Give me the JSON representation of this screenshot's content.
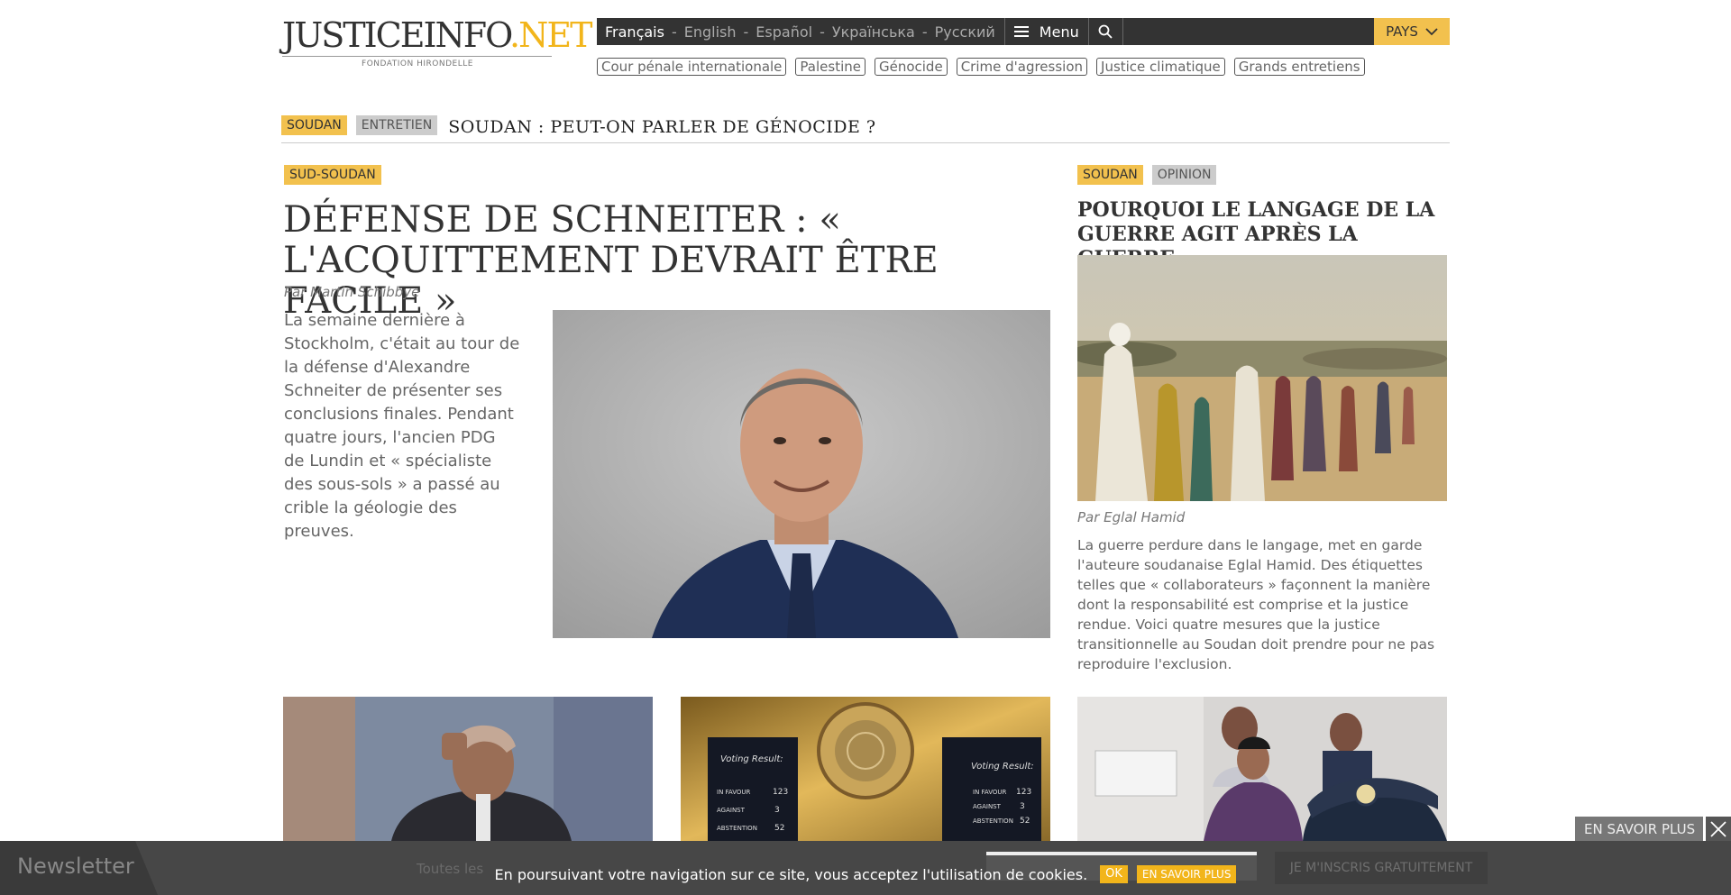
{
  "logo": {
    "justice": "JUSTICEINFO",
    "dot": ".",
    "net": "NET",
    "subtitle": "FONDATION HIRONDELLE"
  },
  "header": {
    "languages": [
      {
        "label": "Français",
        "active": true
      },
      {
        "label": "English",
        "active": false
      },
      {
        "label": "Español",
        "active": false
      },
      {
        "label": "Українська",
        "active": false
      },
      {
        "label": "Русский",
        "active": false
      }
    ],
    "separator": "-",
    "menu_label": "Menu",
    "search_placeholder": "",
    "pays_label": "PAYS"
  },
  "tags": [
    "Cour pénale internationale",
    "Palestine",
    "Génocide",
    "Crime d'agression",
    "Justice climatique",
    "Grands entretiens"
  ],
  "breaking": {
    "badge_country": "SOUDAN",
    "badge_type": "ENTRETIEN",
    "title": "SOUDAN : PEUT-ON PARLER DE GÉNOCIDE ?"
  },
  "main_article": {
    "badge": "SUD-SOUDAN",
    "title": "DÉFENSE DE SCHNEITER : « L'ACQUITTEMENT DEVRAIT ÊTRE FACILE »",
    "byline": "Par Martin Schibbye",
    "lead": "La semaine dernière à Stockholm, c'était au tour de la défense d'Alexandre Schneiter de présenter ses conclusions finales. Pendant quatre jours, l'ancien PDG de Lundin et « spécialiste des sous-sols » a passé au crible la géologie des preuves."
  },
  "side_article": {
    "badge_country": "SOUDAN",
    "badge_type": "OPINION",
    "title": "POURQUOI LE LANGAGE DE LA GUERRE AGIT APRÈS LA GUERRE",
    "byline": "Par Eglal Hamid",
    "lead": "La guerre perdure dans le langage, met en garde l'auteure soudanaise Eglal Hamid. Des étiquettes telles que « collaborateurs » façonnent la manière dont la responsabilité est comprise et la justice rendue. Voici quatre mesures que la justice transitionnelle au Soudan doit prendre pour ne pas reproduire l'exclusion."
  },
  "un_board": {
    "left": {
      "title": "Voting Result:",
      "rows": [
        [
          "IN FAVOUR",
          "123"
        ],
        [
          "AGAINST",
          "3"
        ],
        [
          "ABSTENTION",
          "52"
        ]
      ]
    },
    "right": {
      "title": "Voting Result:",
      "rows": [
        [
          "IN FAVOUR",
          "123"
        ],
        [
          "AGAINST",
          "3"
        ],
        [
          "ABSTENTION",
          "52"
        ]
      ]
    }
  },
  "newsletter": {
    "label": "Newsletter",
    "subtitle": "Toutes les",
    "submit_label": "JE M'INSCRIS GRATUITEMENT",
    "more_label": "EN SAVOIR PLUS"
  },
  "cookie": {
    "text": "En poursuivant votre navigation sur ce site, vous acceptez l'utilisation de cookies.",
    "ok_label": "OK",
    "more_label": "EN SAVOIR PLUS"
  },
  "colors": {
    "accent": "#f2b51b",
    "badge_yellow": "#f2c14e",
    "badge_grey": "#cccccc",
    "topbar": "#333333"
  }
}
